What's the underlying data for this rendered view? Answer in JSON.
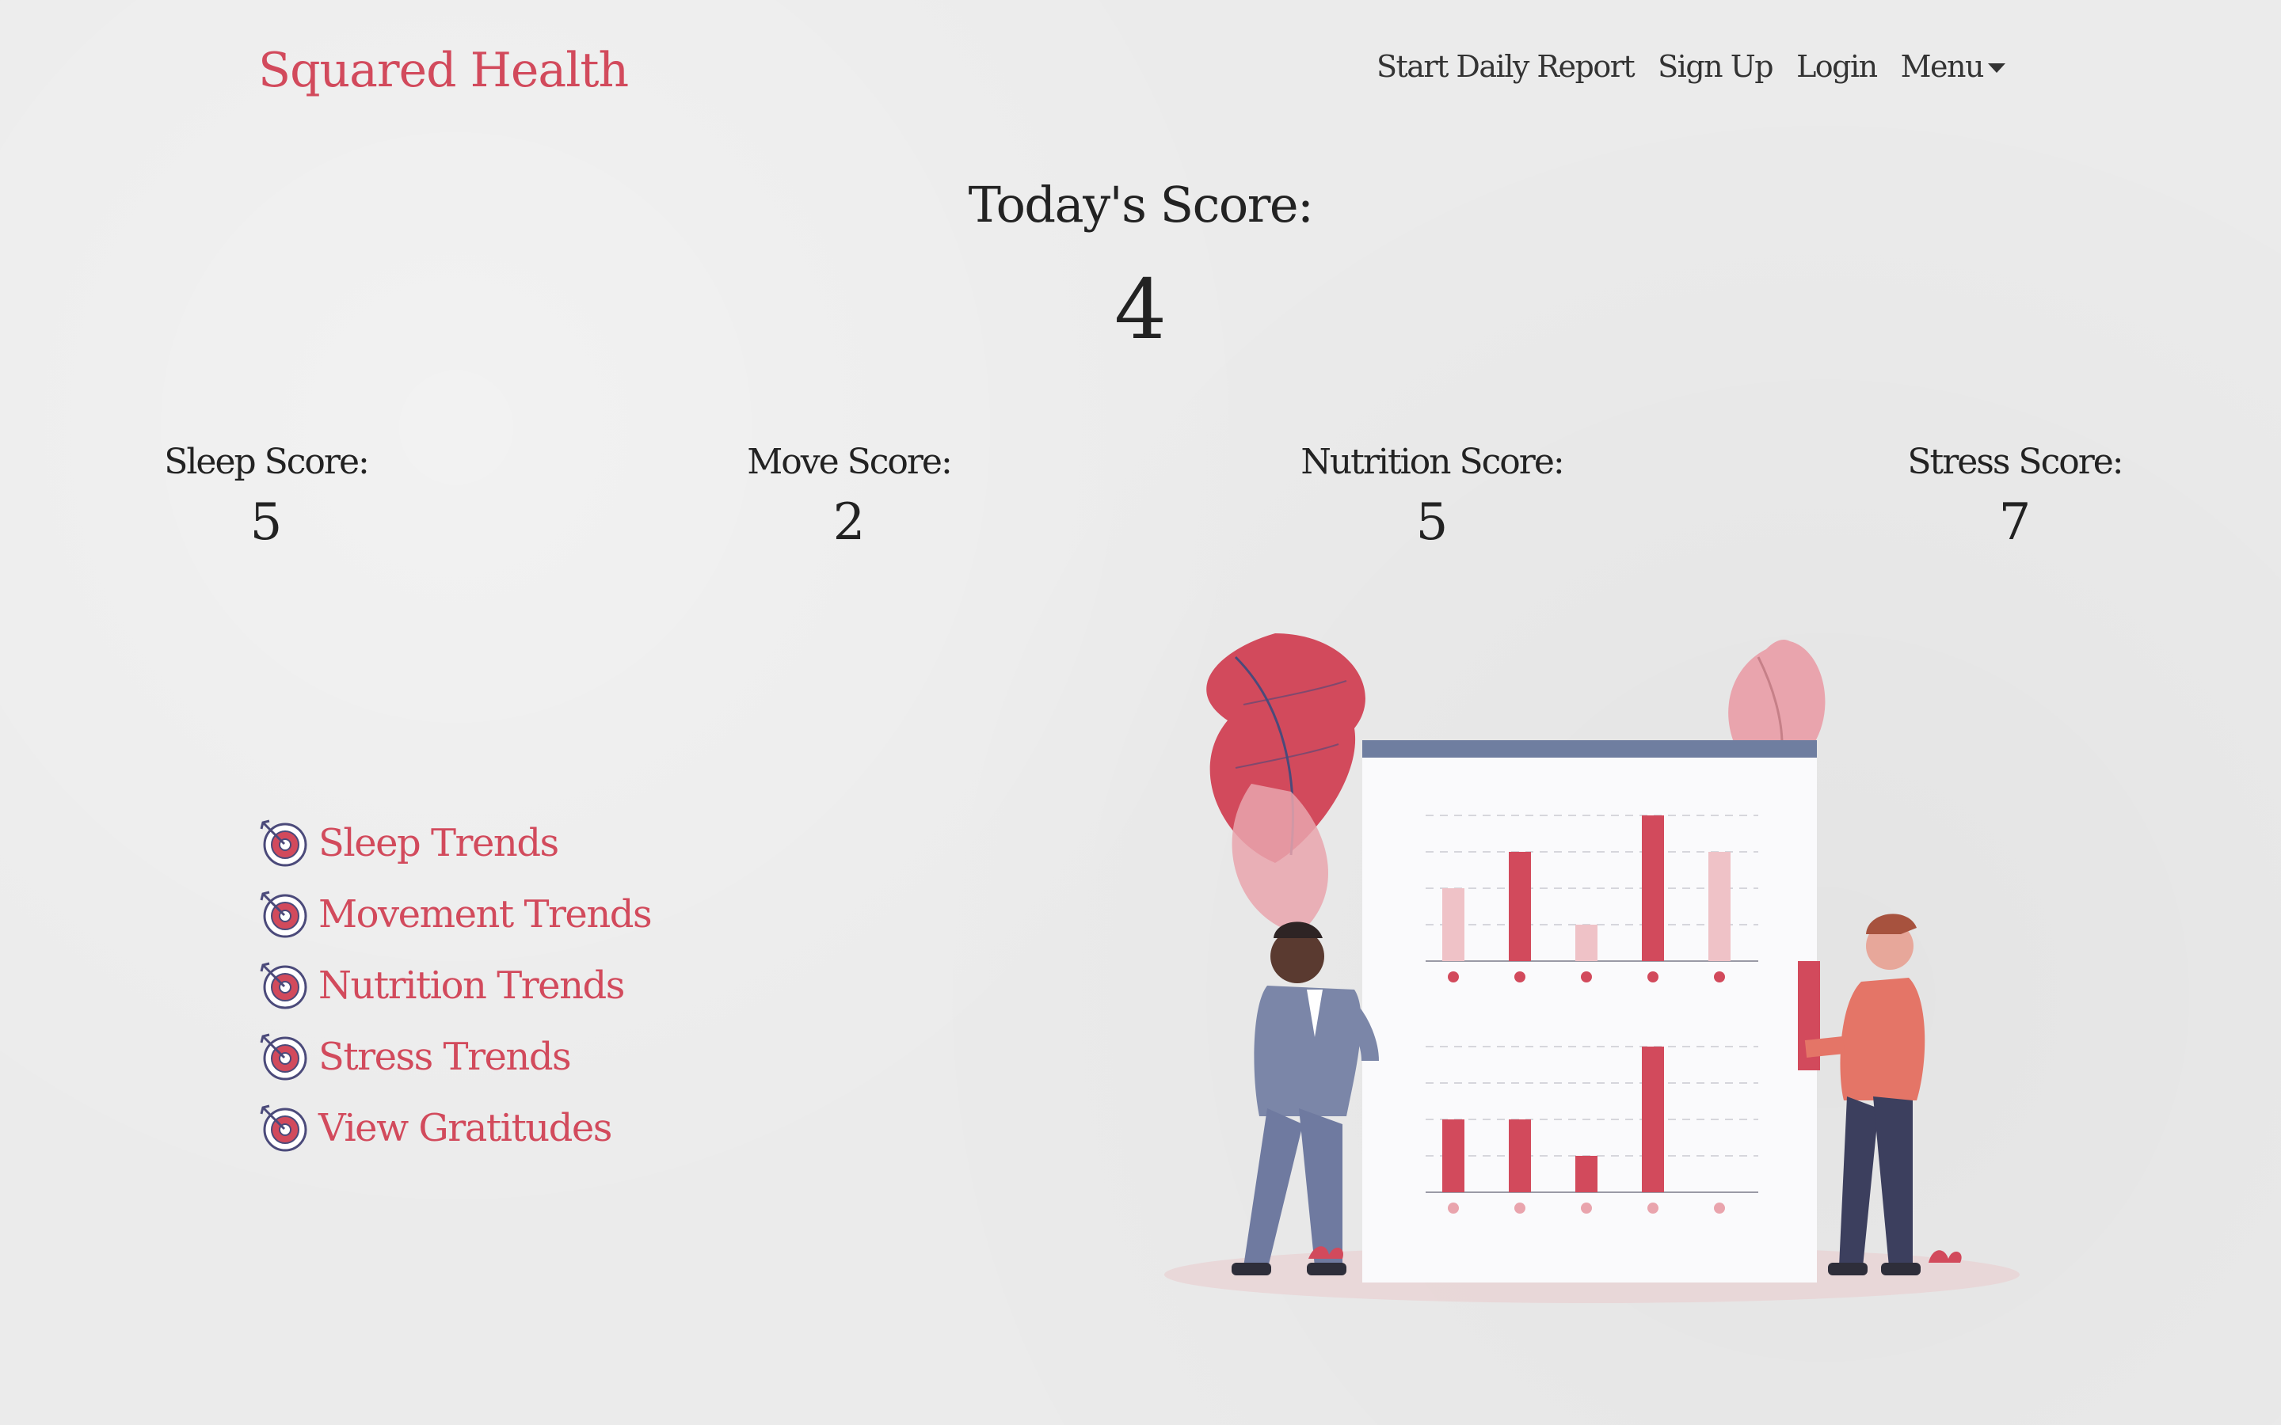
{
  "brand": "Squared Health",
  "nav": {
    "start_report": "Start Daily Report",
    "sign_up": "Sign Up",
    "login": "Login",
    "menu": "Menu"
  },
  "today": {
    "label": "Today's Score:",
    "value": "4"
  },
  "scores": [
    {
      "label": "Sleep Score:",
      "value": "5"
    },
    {
      "label": "Move Score:",
      "value": "2"
    },
    {
      "label": "Nutrition Score:",
      "value": "5"
    },
    {
      "label": "Stress Score:",
      "value": "7"
    }
  ],
  "trends": [
    {
      "label": "Sleep Trends",
      "icon": "target-icon"
    },
    {
      "label": "Movement Trends",
      "icon": "target-icon"
    },
    {
      "label": "Nutrition Trends",
      "icon": "target-icon"
    },
    {
      "label": "Stress Trends",
      "icon": "target-icon"
    },
    {
      "label": "View Gratitudes",
      "icon": "target-icon"
    }
  ],
  "colors": {
    "accent": "#d24a5c",
    "accent_light": "#efc2c7",
    "board_header": "#6f7ea0",
    "background": "#ebebeb"
  }
}
